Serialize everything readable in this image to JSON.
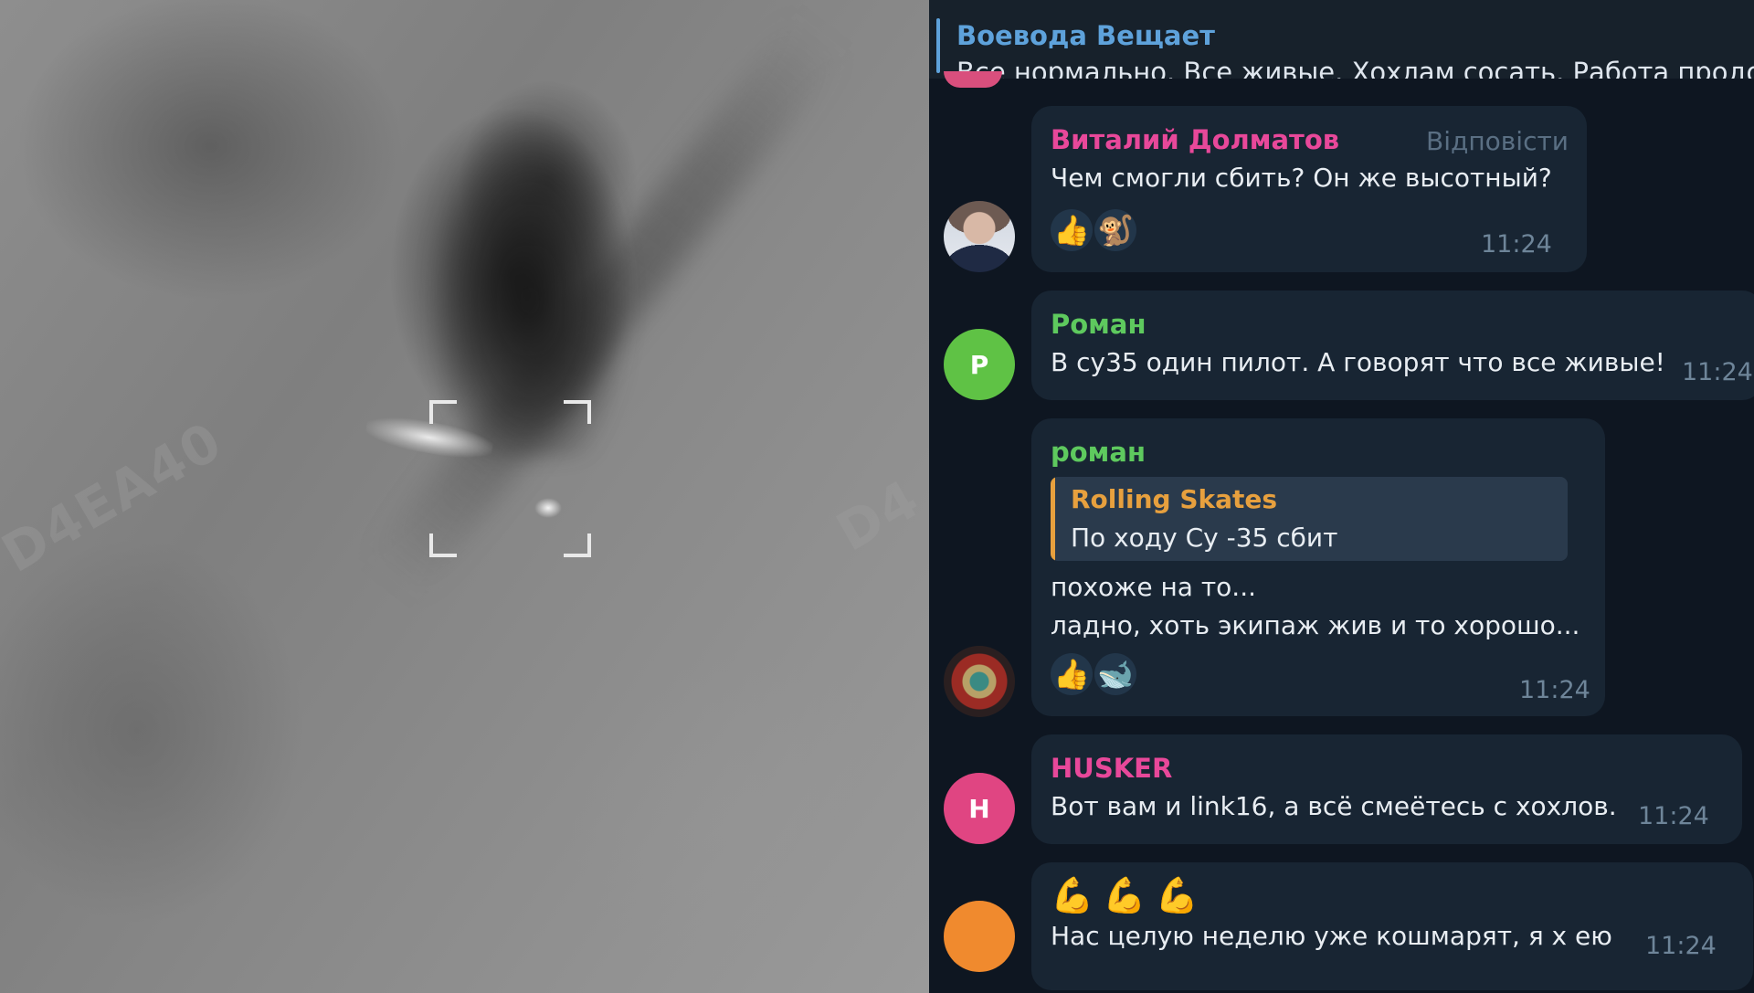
{
  "video": {
    "watermark_left": "D4EA40",
    "watermark_right": "D4"
  },
  "pinned": {
    "title": "Воевода Вещает",
    "preview": "Все нормально. Все живые. Хохлам сосать. Работа продол"
  },
  "messages": [
    {
      "author": "Виталий Долматов",
      "author_color": "#e8489a",
      "reply_label": "Відповісти",
      "text": "Чем смогли сбить? Он же высотный?",
      "reactions": [
        "👍",
        "🐒"
      ],
      "time": "11:24"
    },
    {
      "author": "Роман",
      "author_color": "#5ec95e",
      "avatar_letter": "Р",
      "avatar_color": "#5fc245",
      "text": "В су35 один пилот. А говорят что все живые!",
      "time": "11:24"
    },
    {
      "author": "роман",
      "author_color": "#5ec95e",
      "quote_author": "Rolling Skates",
      "quote_text": "По ходу Су -35 сбит",
      "text_line1": "похоже на то...",
      "text_line2": "ладно, хоть экипаж жив и то хорошо...",
      "reactions": [
        "👍",
        "🐋"
      ],
      "time": "11:24"
    },
    {
      "author": "HUSKER",
      "author_color": "#e8489a",
      "avatar_letter": "H",
      "avatar_color": "#e04582",
      "text": "Вот вам и link16, а всё смеётесь с хохлов.",
      "time": "11:24"
    },
    {
      "stickers": [
        "💪",
        "💪",
        "💪"
      ],
      "avatar_color": "#f08a2e",
      "text": "Нас целую неделю уже кошмарят, я х  ею",
      "time": "11:24"
    }
  ]
}
